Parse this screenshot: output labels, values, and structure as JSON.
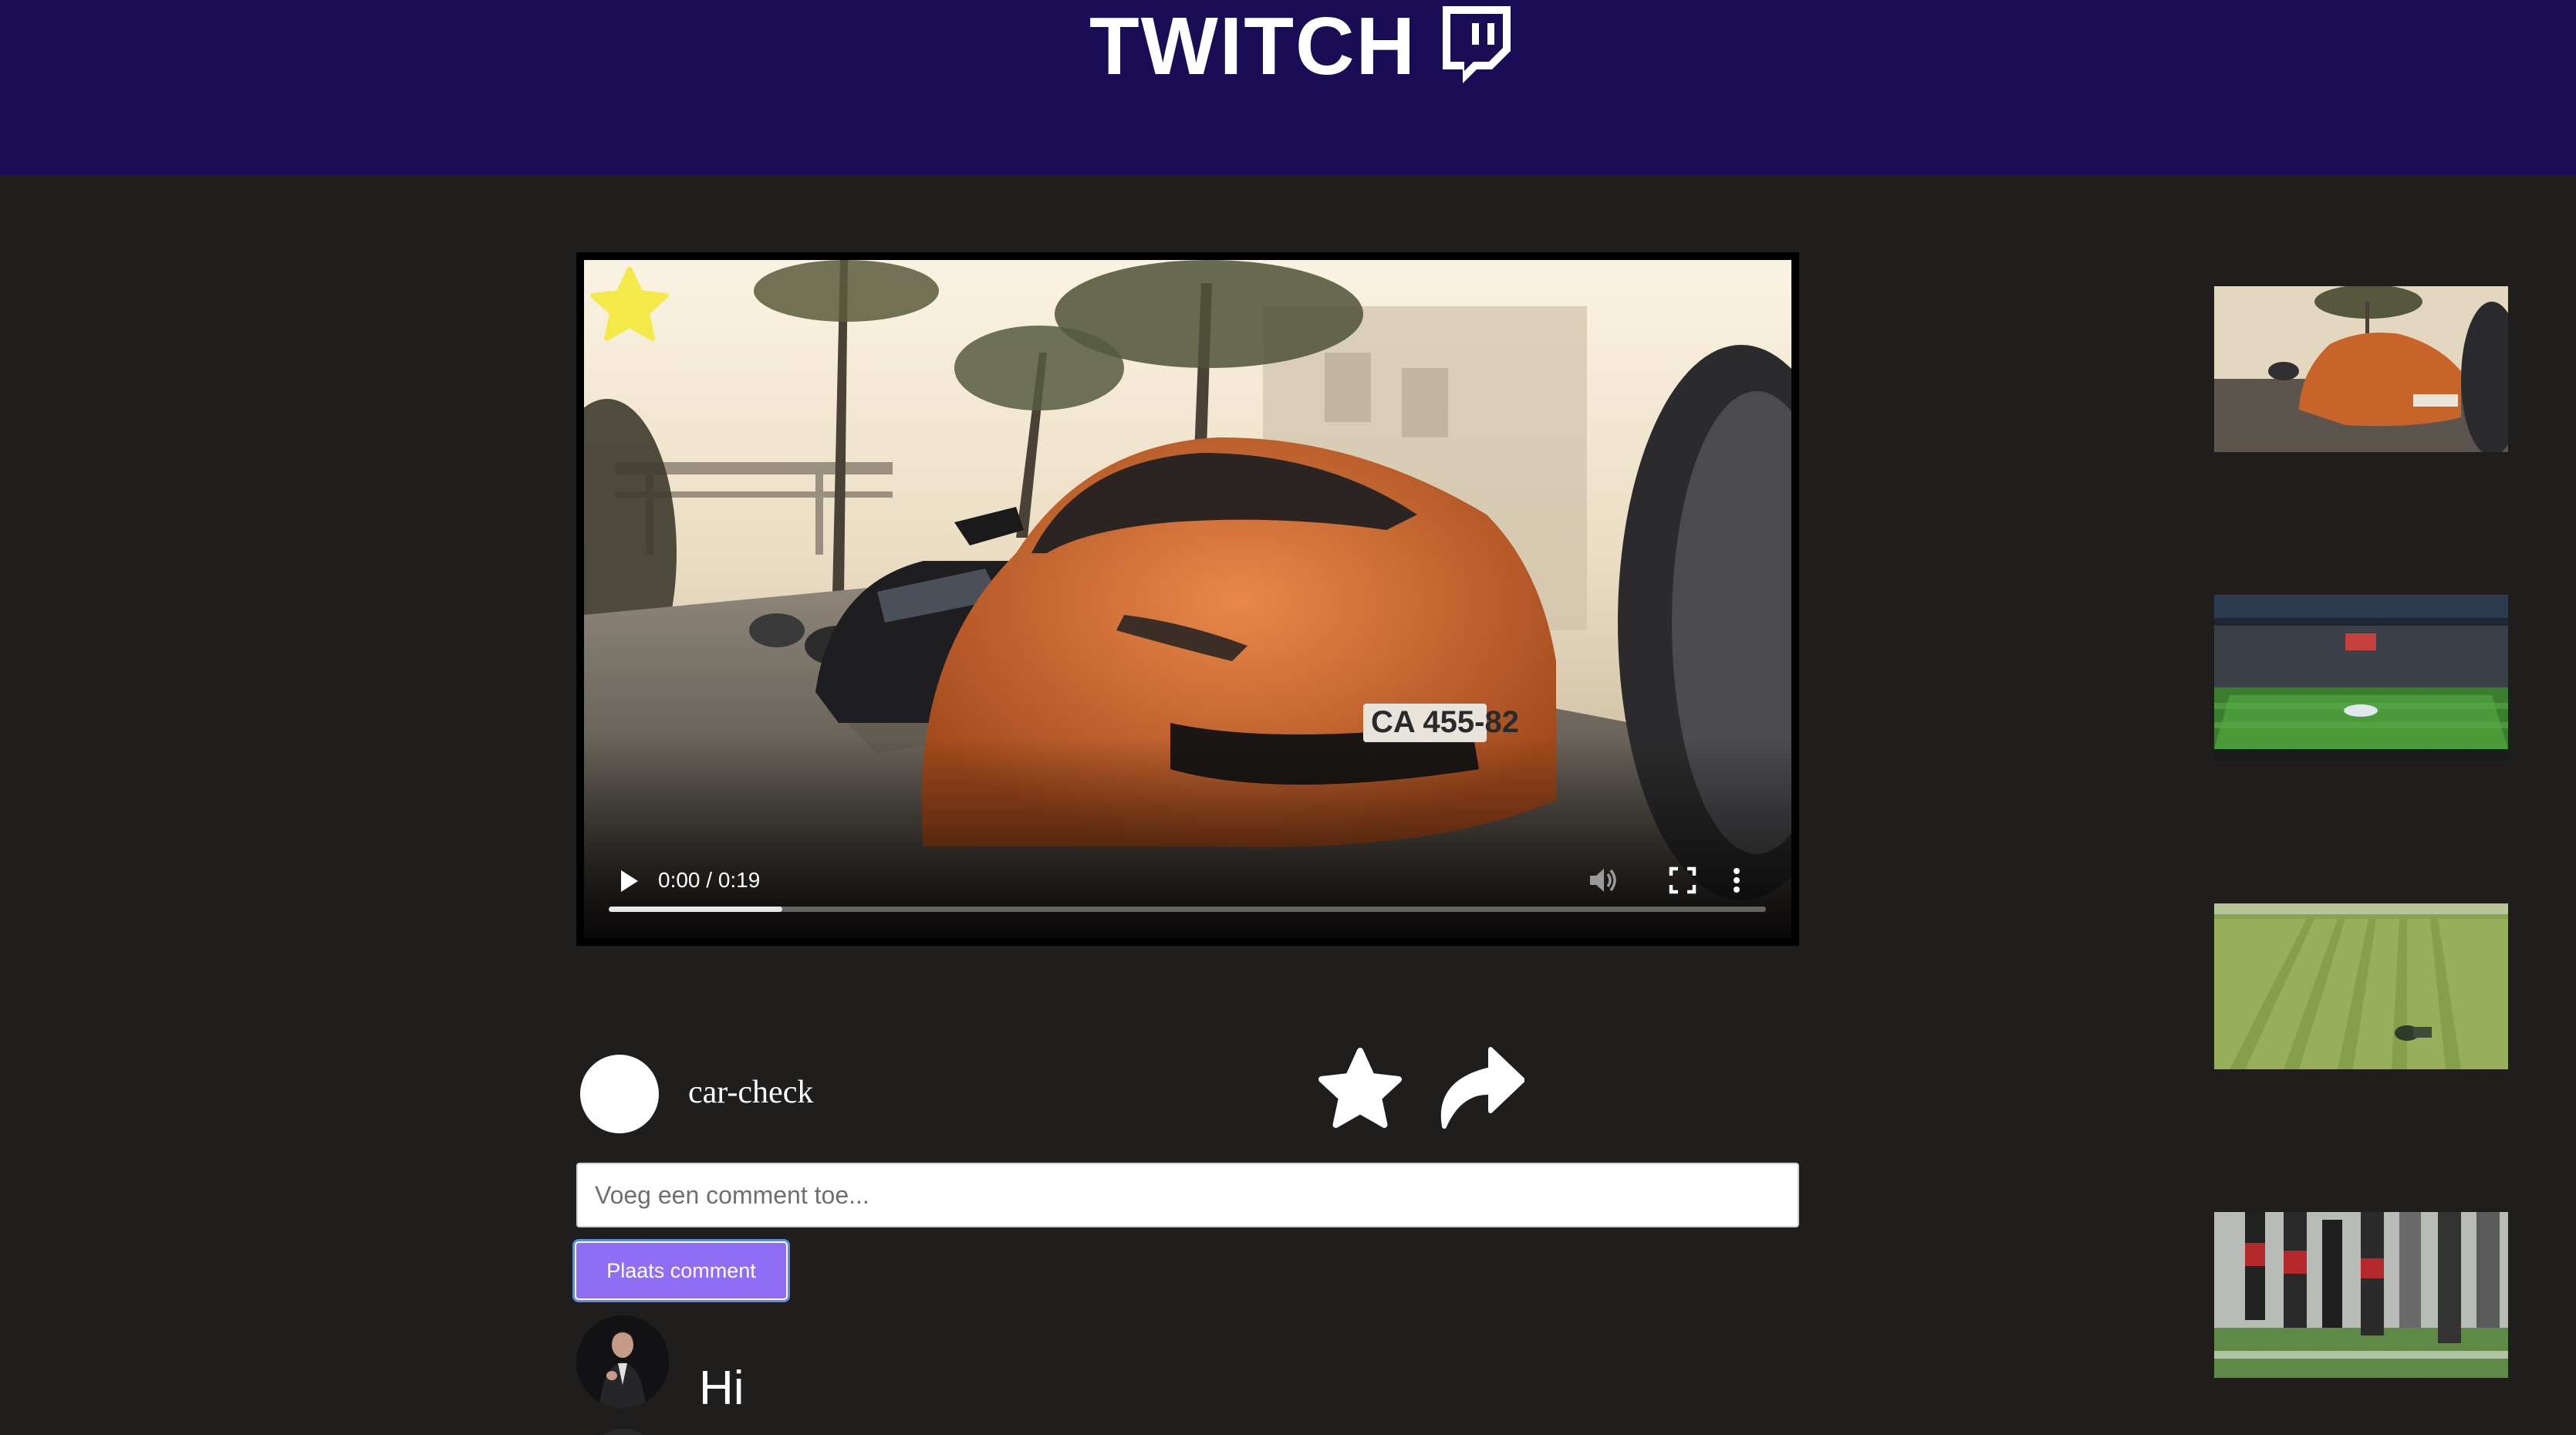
{
  "header": {
    "brand": "TWITCH",
    "logo_icon": "twitch-glitch-icon",
    "background": "#1b0d55"
  },
  "player": {
    "time_display": "0:00 / 0:19",
    "progress": 0.15,
    "favorite_icon": "star-icon",
    "favorite_color": "#f3ea4a",
    "controls": [
      "play-icon",
      "volume-icon",
      "fullscreen-icon",
      "more-vertical-icon"
    ]
  },
  "channel": {
    "name": "car-check",
    "actions": [
      "star-icon",
      "share-arrow-icon"
    ]
  },
  "comment_form": {
    "placeholder": "Voeg een comment toe...",
    "value": "",
    "submit_label": "Plaats comment",
    "submit_color": "#8f6df5"
  },
  "comments": [
    {
      "text": "Hi"
    }
  ],
  "sidebar": {
    "thumbnails": [
      {
        "subject": "orange sports car on palm street"
      },
      {
        "subject": "football stadium"
      },
      {
        "subject": "mown grass field with tractor"
      },
      {
        "subject": "football team players"
      }
    ]
  },
  "colors": {
    "page_background": "#1f1e1d",
    "accent": "#8f6df5"
  }
}
